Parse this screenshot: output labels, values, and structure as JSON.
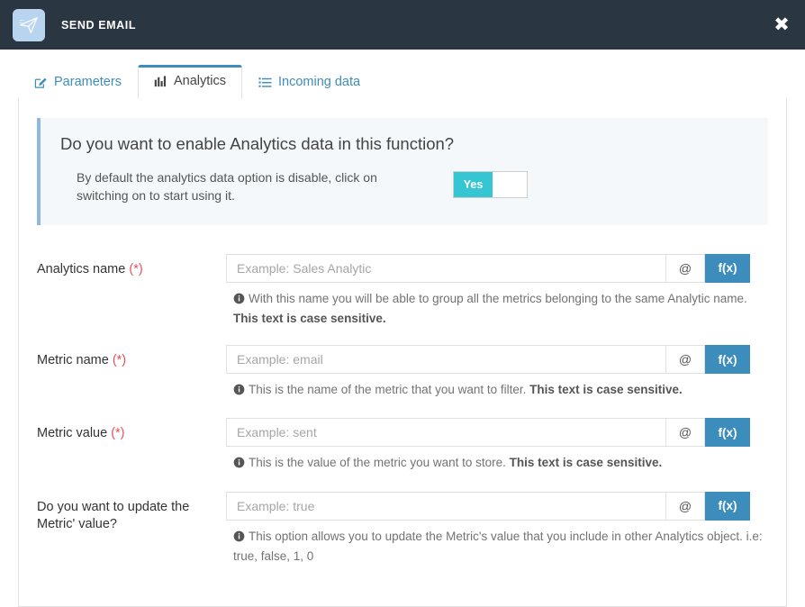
{
  "header": {
    "title": "SEND EMAIL",
    "icon": "send-email-icon",
    "close_label": "✖",
    "bg_color": "#2b3643",
    "icon_bg_color": "#b9d4ef"
  },
  "tabs": [
    {
      "label": "Parameters",
      "icon": "edit-square-icon",
      "active": false
    },
    {
      "label": "Analytics",
      "icon": "bar-chart-icon",
      "active": true
    },
    {
      "label": "Incoming data",
      "icon": "list-icon",
      "active": false
    }
  ],
  "callout": {
    "title": "Do you want to enable Analytics data in this function?",
    "description": "By default the analytics data option is disable, click on switching on to start using it.",
    "toggle": {
      "state_label": "Yes",
      "on": true,
      "on_color": "#36c6d3"
    },
    "accent_color": "#8fb8e0",
    "bg_color": "#f4f8fa"
  },
  "form": {
    "addon_at_label": "@",
    "addon_fx_label": "f(x)",
    "addon_fx_color": "#3c8dbc",
    "required_marker": "(*)",
    "fields": [
      {
        "label": "Analytics name",
        "required": true,
        "value": "",
        "placeholder": "Example: Sales Analytic",
        "help_plain": "With this name you will be able to group all the metrics belonging to the same Analytic name. ",
        "help_bold": "This text is case sensitive."
      },
      {
        "label": "Metric name",
        "required": true,
        "value": "",
        "placeholder": "Example: email",
        "help_plain": "This is the name of the metric that you want to filter. ",
        "help_bold": "This text is case sensitive."
      },
      {
        "label": "Metric value",
        "required": true,
        "value": "",
        "placeholder": "Example: sent",
        "help_plain": "This is the value of the metric you want to store. ",
        "help_bold": "This text is case sensitive."
      },
      {
        "label": "Do you want to update the Metric' value?",
        "required": false,
        "value": "",
        "placeholder": "Example: true",
        "help_plain": "This option allows you to update the Metric's value that you include in other Analytics object. i.e: true, false, 1, 0",
        "help_bold": ""
      }
    ]
  }
}
